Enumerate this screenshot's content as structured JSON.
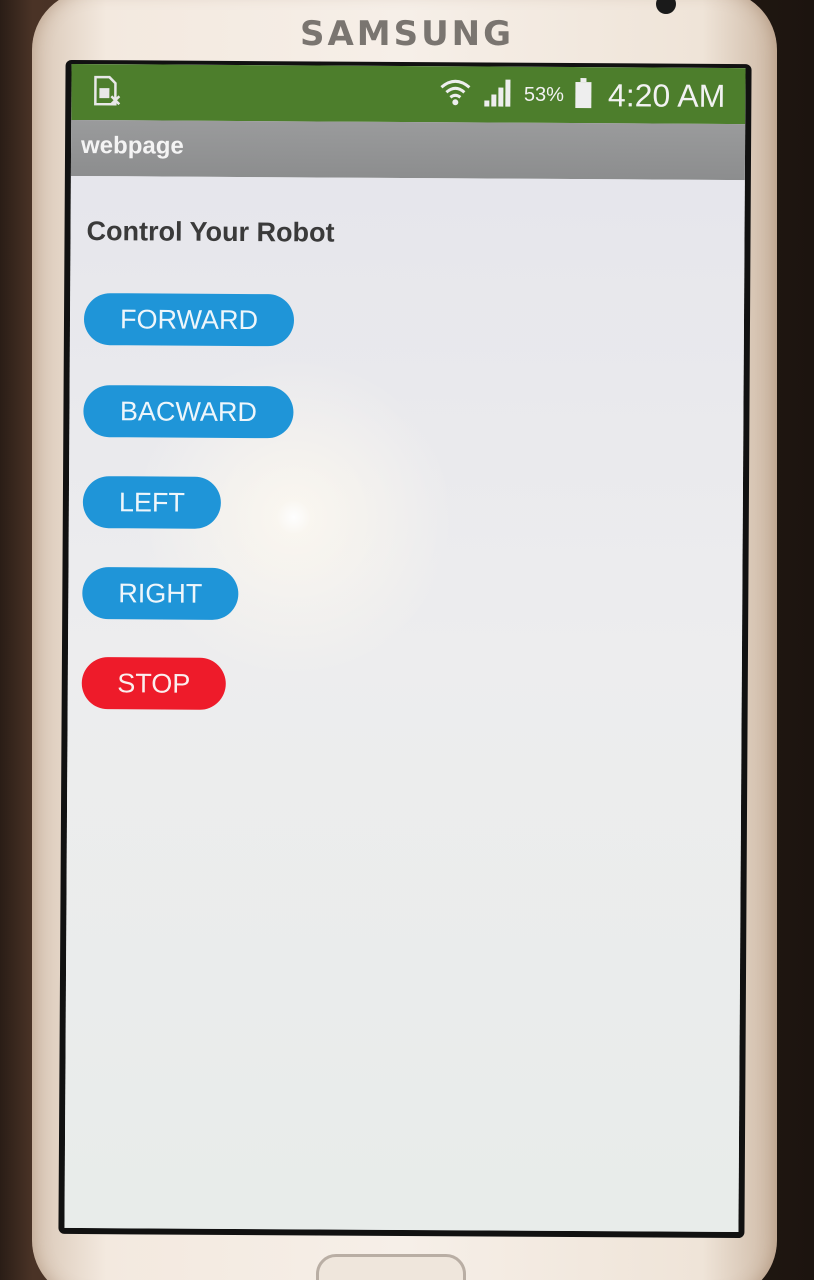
{
  "device": {
    "brand": "SAMSUNG"
  },
  "status_bar": {
    "battery_percent": "53%",
    "time": "4:20 AM",
    "icons": [
      "sim-card-icon",
      "wifi-icon",
      "signal-icon",
      "battery-icon"
    ],
    "color": "#4d7e2c"
  },
  "app": {
    "title": "webpage"
  },
  "page": {
    "heading": "Control Your Robot",
    "buttons": {
      "forward": "FORWARD",
      "backward": "BACWARD",
      "left": "LEFT",
      "right": "RIGHT",
      "stop": "STOP"
    },
    "colors": {
      "primary_button": "#1f95d8",
      "stop_button": "#ee1b2a"
    }
  }
}
